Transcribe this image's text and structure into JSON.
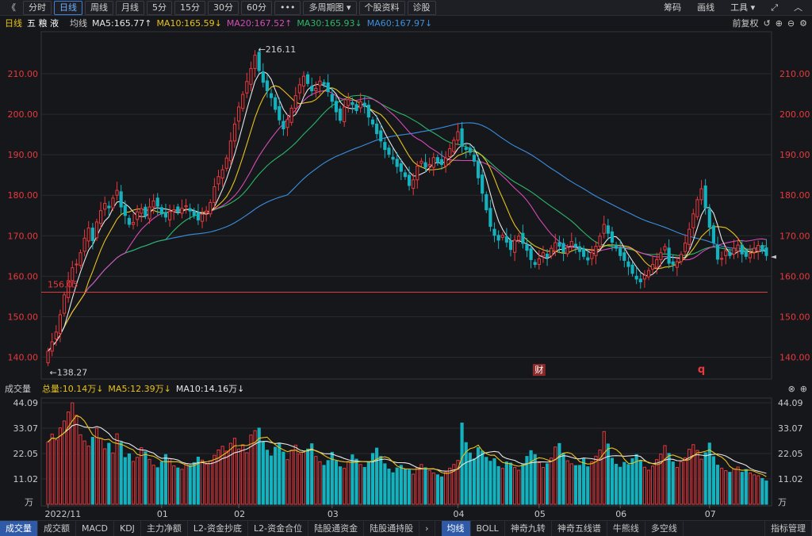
{
  "toolbar": {
    "back_glyph": "《",
    "tabs": [
      {
        "label": "分时",
        "active": false
      },
      {
        "label": "日线",
        "active": true
      },
      {
        "label": "周线",
        "active": false
      },
      {
        "label": "月线",
        "active": false
      },
      {
        "label": "5分",
        "active": false
      },
      {
        "label": "15分",
        "active": false
      },
      {
        "label": "30分",
        "active": false
      },
      {
        "label": "60分",
        "active": false
      }
    ],
    "more": "•••",
    "multi_period": "多周期图",
    "stock_info": "个股资料",
    "diagnose": "诊股",
    "right": [
      "筹码",
      "画线",
      "工具"
    ]
  },
  "info": {
    "period": "日线",
    "stock_name": "五 粮 液",
    "avg_label": "均线",
    "ma5": "MA5:165.77↑",
    "ma10": "MA10:165.59↓",
    "ma20": "MA20:167.52↑",
    "ma30": "MA30:165.93↓",
    "ma60": "MA60:167.97↓",
    "adjust": "前复权"
  },
  "colors": {
    "up": "#e8393d",
    "down": "#14b2bf",
    "ma5": "#e6e6e6",
    "ma10": "#e8c21c",
    "ma20": "#d54bb6",
    "ma30": "#2ab866",
    "ma60": "#3a8fe0",
    "axis_label": "#e8393d",
    "vol_axis": "#c8c8c8",
    "grid": "#2a2b31"
  },
  "price_axis": {
    "ticks": [
      "210.00",
      "200.00",
      "190.00",
      "180.00",
      "170.00",
      "160.00",
      "150.00",
      "140.00"
    ],
    "min": 135,
    "max": 220
  },
  "annotations": {
    "high": "←216.11",
    "low": "←138.27",
    "support": "156.05",
    "support_value": 156.05,
    "badge_fin": "财",
    "badge_q": "q"
  },
  "volume": {
    "title": "成交量",
    "total": "总量:10.14万↓",
    "ma5": "MA5:12.39万↓",
    "ma10": "MA10:14.16万↓",
    "ticks": [
      "44.09",
      "33.07",
      "22.05",
      "11.02"
    ],
    "unit": "万",
    "max": 44.09
  },
  "x_axis": [
    "2022/11",
    "01",
    "02",
    "03",
    "04",
    "05",
    "06",
    "07"
  ],
  "bottom_tabs": [
    "成交量",
    "成交额",
    "MACD",
    "KDJ",
    "主力净额",
    "L2-资金抄底",
    "L2-资金合位",
    "陆股通资金",
    "陆股通持股",
    "›",
    "均线",
    "BOLL",
    "神奇九转",
    "神奇五线谱",
    "牛熊线",
    "多空线",
    "指标管理"
  ],
  "bottom_tabs_active": [
    "成交量",
    "均线"
  ],
  "chart_data": {
    "type": "candlestick",
    "ylim": [
      135,
      220
    ],
    "highest": 216.11,
    "lowest": 138.27,
    "close": [
      141.5,
      143.8,
      146.2,
      150.5,
      155.4,
      158.9,
      162.1,
      163.0,
      165.8,
      169.4,
      171.9,
      168.8,
      173.4,
      176.2,
      178.0,
      176.9,
      179.3,
      181.2,
      177.1,
      175.0,
      172.8,
      173.3,
      175.9,
      176.7,
      174.9,
      177.1,
      178.6,
      177.3,
      175.4,
      174.6,
      176.0,
      176.4,
      175.9,
      176.8,
      177.4,
      176.1,
      175.0,
      173.9,
      175.3,
      176.1,
      178.2,
      182.1,
      184.6,
      186.3,
      189.2,
      193.4,
      197.6,
      201.8,
      204.9,
      208.1,
      211.3,
      214.6,
      210.8,
      207.9,
      205.8,
      204.1,
      201.2,
      198.6,
      196.4,
      198.7,
      201.5,
      204.6,
      207.3,
      209.4,
      207.6,
      205.8,
      206.4,
      208.2,
      207.4,
      205.6,
      203.2,
      200.6,
      198.5,
      201.8,
      203.6,
      202.4,
      200.9,
      203.1,
      201.9,
      199.3,
      197.6,
      195.2,
      193.4,
      191.3,
      190.1,
      188.9,
      187.1,
      185.9,
      184.6,
      182.4,
      183.8,
      187.2,
      188.4,
      186.9,
      187.6,
      189.3,
      188.1,
      187.6,
      189.2,
      191.5,
      193.6,
      195.7,
      192.1,
      191.3,
      190.6,
      188.4,
      184.3,
      180.5,
      176.4,
      172.3,
      170.1,
      168.9,
      170.1,
      168.4,
      166.6,
      168.9,
      169.9,
      168.1,
      166.4,
      164.1,
      162.9,
      164.3,
      165.8,
      164.7,
      166.9,
      168.3,
      167.4,
      165.9,
      167.1,
      168.6,
      167.3,
      166.1,
      164.9,
      164.0,
      165.8,
      167.4,
      169.9,
      172.8,
      170.6,
      168.4,
      166.9,
      165.1,
      163.9,
      162.4,
      160.7,
      159.3,
      158.6,
      160.2,
      161.4,
      162.9,
      164.1,
      165.8,
      167.3,
      163.2,
      162.9,
      163.6,
      165.4,
      168.2,
      171.6,
      175.4,
      178.9,
      181.6,
      176.9,
      172.1,
      168.3,
      164.2,
      164.4,
      166.3,
      165.1,
      166.9,
      167.7,
      165.5,
      164.9,
      165.6,
      166.9,
      167.6,
      166.3,
      165.1
    ],
    "volume": [
      27.1,
      30.5,
      28.0,
      33.2,
      36.2,
      40.1,
      44.1,
      38.7,
      30.2,
      27.5,
      25.3,
      29.1,
      33.0,
      28.6,
      24.1,
      26.5,
      22.3,
      30.6,
      26.9,
      20.3,
      21.9,
      18.6,
      20.4,
      24.6,
      22.8,
      19.5,
      17.0,
      15.9,
      18.4,
      21.6,
      19.8,
      16.7,
      15.8,
      15.2,
      17.7,
      16.9,
      18.1,
      20.5,
      19.2,
      17.4,
      18.9,
      21.3,
      23.6,
      25.2,
      23.1,
      26.5,
      28.7,
      24.0,
      25.9,
      22.4,
      30.1,
      32.0,
      33.1,
      27.2,
      23.5,
      21.0,
      24.8,
      26.3,
      22.7,
      19.4,
      23.5,
      25.7,
      21.9,
      22.7,
      24.0,
      26.3,
      20.8,
      18.5,
      16.9,
      19.0,
      22.6,
      18.8,
      16.3,
      15.6,
      18.6,
      21.5,
      19.6,
      17.3,
      16.0,
      18.3,
      22.1,
      24.4,
      20.8,
      17.6,
      15.3,
      13.7,
      15.8,
      16.9,
      15.3,
      14.9,
      13.1,
      15.9,
      17.3,
      15.9,
      14.7,
      13.6,
      12.8,
      11.9,
      13.9,
      15.7,
      17.3,
      19.1,
      35.3,
      26.8,
      22.3,
      19.7,
      24.6,
      23.1,
      20.4,
      18.7,
      19.8,
      16.4,
      15.6,
      18.4,
      17.9,
      16.0,
      14.8,
      17.3,
      20.8,
      23.3,
      21.6,
      18.1,
      16.0,
      17.6,
      20.1,
      24.9,
      26.4,
      22.2,
      18.9,
      17.6,
      16.8,
      16.9,
      19.7,
      16.3,
      18.5,
      20.9,
      23.6,
      31.6,
      26.2,
      20.0,
      17.4,
      16.1,
      18.2,
      17.3,
      19.8,
      21.6,
      19.0,
      16.1,
      14.8,
      16.6,
      19.4,
      21.8,
      25.5,
      22.1,
      18.4,
      16.0,
      18.5,
      20.2,
      23.9,
      25.9,
      23.4,
      19.6,
      22.4,
      26.6,
      20.7,
      17.0,
      15.7,
      14.6,
      13.9,
      15.3,
      16.2,
      13.9,
      15.1,
      13.6,
      12.8,
      12.4,
      11.2,
      10.14
    ]
  }
}
